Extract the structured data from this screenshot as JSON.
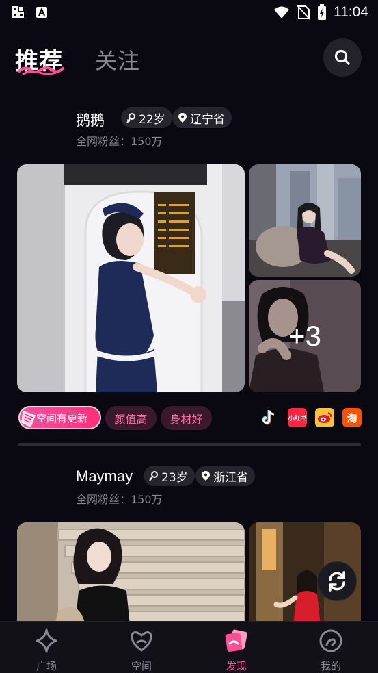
{
  "status_bar": {
    "time": "11:04"
  },
  "tabs": {
    "active": "推荐",
    "inactive": "关注"
  },
  "cards": [
    {
      "name": "鹅鹅",
      "age": "22岁",
      "location": "辽宁省",
      "fans": "全网粉丝：150万",
      "more_count": "+3",
      "update_badge": "空间有更新",
      "tags": [
        "颜值高",
        "身材好"
      ],
      "socials": [
        "douyin",
        "小红书",
        "weibo",
        "淘"
      ]
    },
    {
      "name": "Maymay",
      "age": "23岁",
      "location": "浙江省",
      "fans": "全网粉丝：150万"
    }
  ],
  "bottom_nav": [
    {
      "label": "广场",
      "icon": "diamond-star-icon"
    },
    {
      "label": "空间",
      "icon": "heart-link-icon"
    },
    {
      "label": "发现",
      "icon": "discover-cards-icon",
      "active": true
    },
    {
      "label": "我的",
      "icon": "profile-swirl-icon"
    }
  ],
  "colors": {
    "accent": "#ff4f96",
    "background": "#0a0810",
    "pill": "#26242c",
    "tag_bg": "#3a1a2a"
  }
}
